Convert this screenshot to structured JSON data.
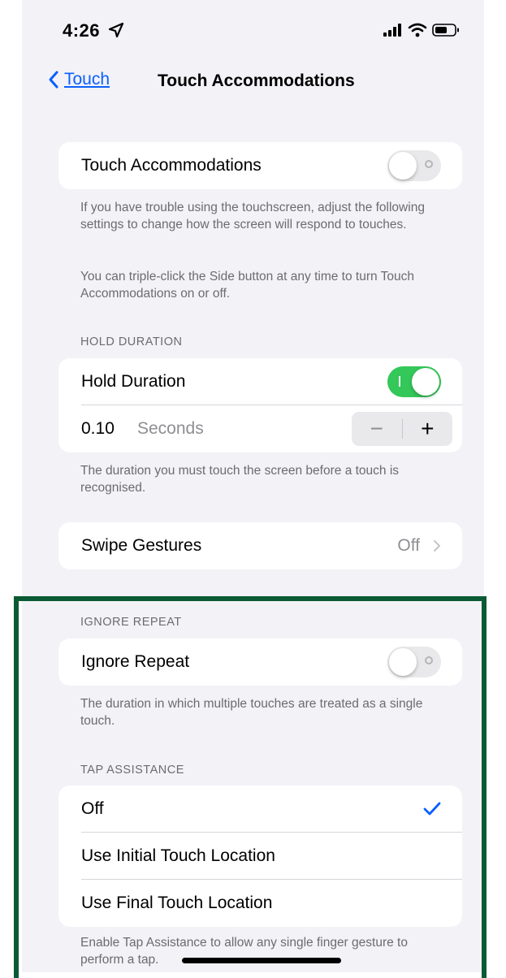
{
  "status_bar": {
    "time": "4:26"
  },
  "nav": {
    "back_label": "Touch",
    "title": "Touch Accommodations"
  },
  "touch_accommodations": {
    "label": "Touch Accommodations",
    "enabled": false,
    "footer_1": "If you have trouble using the touchscreen, adjust the following settings to change how the screen will respond to touches.",
    "footer_2": "You can triple-click the Side button at any time to turn Touch Accommodations on or off."
  },
  "hold_duration": {
    "header": "HOLD DURATION",
    "label": "Hold Duration",
    "enabled": true,
    "value": "0.10",
    "unit": "Seconds",
    "minus": "−",
    "plus": "+",
    "footer": "The duration you must touch the screen before a touch is recognised."
  },
  "swipe_gestures": {
    "label": "Swipe Gestures",
    "value": "Off"
  },
  "ignore_repeat": {
    "header": "IGNORE REPEAT",
    "label": "Ignore Repeat",
    "enabled": false,
    "footer": "The duration in which multiple touches are treated as a single touch."
  },
  "tap_assistance": {
    "header": "TAP ASSISTANCE",
    "options": [
      "Off",
      "Use Initial Touch Location",
      "Use Final Touch Location"
    ],
    "selected": "Off",
    "footer": "Enable Tap Assistance to allow any single finger gesture to perform a tap."
  },
  "colors": {
    "accent": "#0a60ff",
    "switch_on": "#34c759",
    "highlight_border": "#0b5a33",
    "background": "#f2f2f7"
  }
}
